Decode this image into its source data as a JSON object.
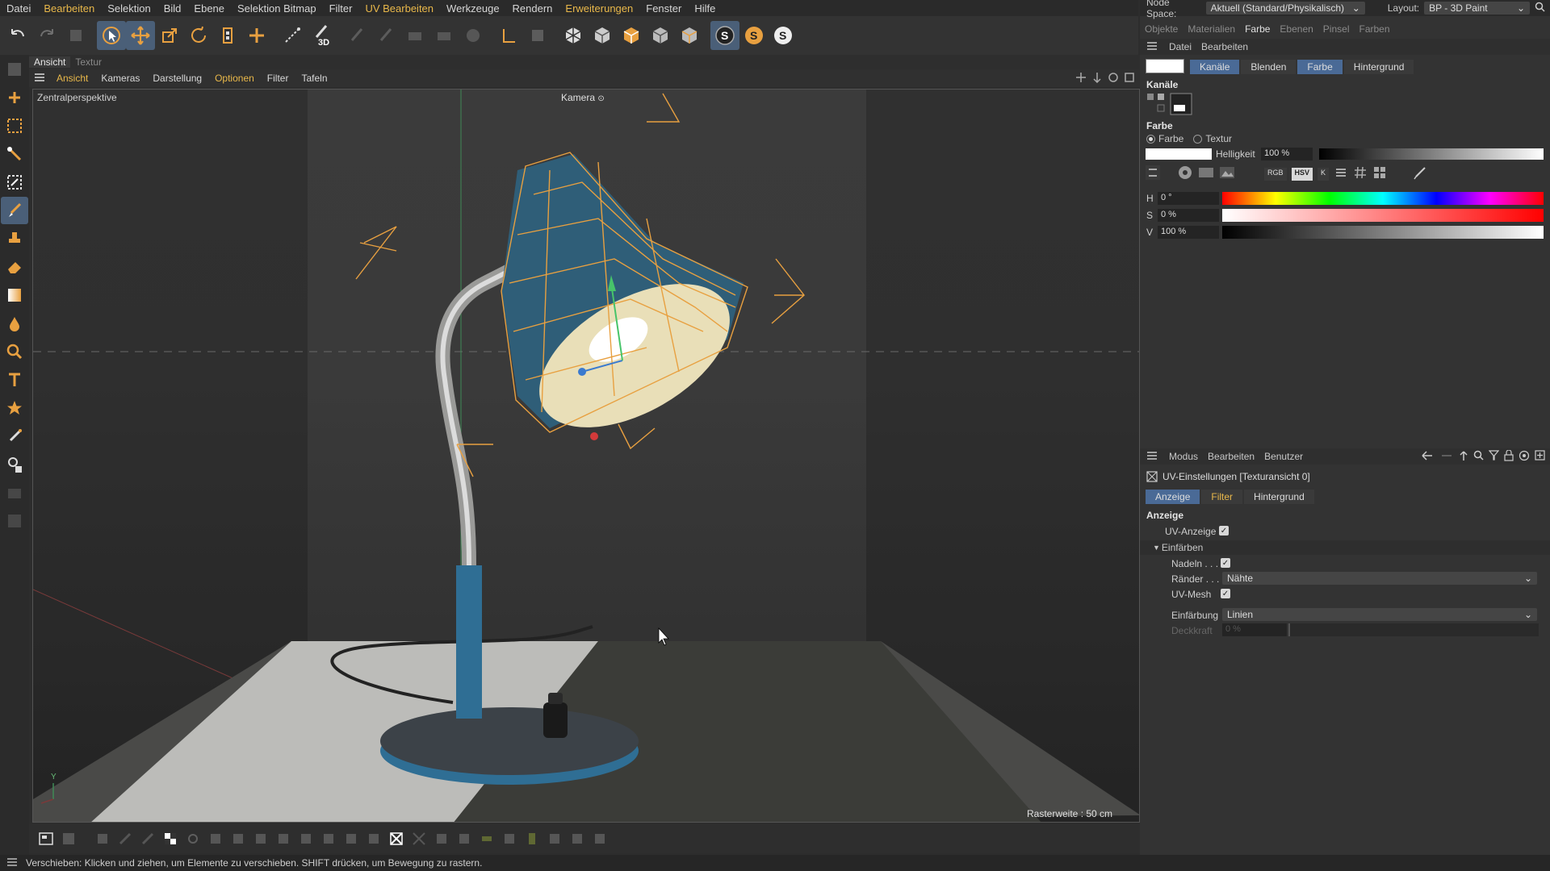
{
  "menu": [
    "Datei",
    "Bearbeiten",
    "Selektion",
    "Bild",
    "Ebene",
    "Selektion Bitmap",
    "Filter",
    "UV Bearbeiten",
    "Werkzeuge",
    "Rendern",
    "Erweiterungen",
    "Fenster",
    "Hilfe"
  ],
  "menu_highlight": [
    "Bearbeiten",
    "UV Bearbeiten",
    "Erweiterungen"
  ],
  "viewport": {
    "tabs": [
      "Ansicht",
      "Textur"
    ],
    "menu": [
      "Ansicht",
      "Kameras",
      "Darstellung",
      "Optionen",
      "Filter",
      "Tafeln"
    ],
    "menu_highlight": [
      "Ansicht",
      "Optionen"
    ],
    "projection": "Zentralperspektive",
    "camera": "Kamera",
    "grid": "Rasterweite : 50 cm",
    "axis_y": "Y"
  },
  "right": {
    "node_space_label": "Node Space:",
    "node_space_value": "Aktuell (Standard/Physikalisch)",
    "layout_label": "Layout:",
    "layout_value": "BP - 3D Paint",
    "tabs": [
      "Objekte",
      "Materialien",
      "Farbe",
      "Ebenen",
      "Pinsel",
      "Farben"
    ],
    "active_tab": "Farbe",
    "sub_menu": [
      "Datei",
      "Bearbeiten"
    ],
    "color_tabs": [
      "Kanäle",
      "Blenden",
      "Farbe",
      "Hintergrund"
    ],
    "color_active_tabs": [
      "Kanäle",
      "Farbe"
    ],
    "channels_title": "Kanäle",
    "color_section": "Farbe",
    "radio_color": "Farbe",
    "radio_texture": "Textur",
    "brightness_label": "Helligkeit",
    "brightness_value": "100 %",
    "mode_buttons": [
      "RGB",
      "HSV",
      "K"
    ],
    "h_label": "H",
    "h_value": "0 °",
    "s_label": "S",
    "s_value": "0 %",
    "v_label": "V",
    "v_value": "100 %",
    "attr_menu": [
      "Modus",
      "Bearbeiten",
      "Benutzer"
    ],
    "uv_title": "UV-Einstellungen [Texturansicht 0]",
    "uv_tabs": [
      "Anzeige",
      "Filter",
      "Hintergrund"
    ],
    "uv_active": "Anzeige",
    "anzeige_section": "Anzeige",
    "uv_anzeige_label": "UV-Anzeige",
    "einfaerben_label": "Einfärben",
    "nadeln_label": "Nadeln . . .",
    "raender_label": "Ränder . . .",
    "raender_value": "Nähte",
    "uvmesh_label": "UV-Mesh",
    "einfaerbung_label": "Einfärbung",
    "einfaerbung_value": "Linien",
    "deckkraft_label": "Deckkraft",
    "deckkraft_value": "0 %"
  },
  "status": "Verschieben: Klicken und ziehen, um Elemente zu verschieben. SHIFT drücken, um Bewegung zu rastern.",
  "colors": {
    "accent": "#e9b84a",
    "selected": "#4a6a96",
    "orange_wire": "#e8a040"
  }
}
